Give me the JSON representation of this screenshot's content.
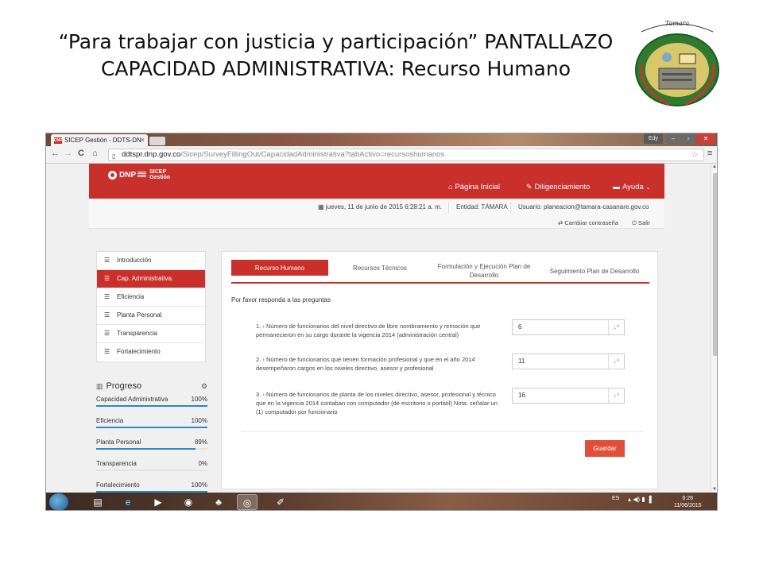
{
  "slide": {
    "title": "“Para trabajar con justicia y participación” PANTALLAZO CAPACIDAD ADMINISTRATIVA: Recurso Humano",
    "crest_text": "Tamara"
  },
  "browser": {
    "tab_title": "SICEP Gestión - DDTS-DN",
    "tab_close": "×",
    "user_button": "Edy",
    "url_host": "ddtspr.dnp.gov.co",
    "url_path": "/Sicep/SurveyFillingOut/CapacidadAdministrativa?tabActivo=recursoshumanos",
    "back": "←",
    "forward": "→",
    "reload": "C",
    "home": "⌂",
    "star": "☆",
    "menu": "≡"
  },
  "site": {
    "logo_dnp": "DNP",
    "logo_sicep": "SICEP",
    "logo_gestion": "Gestión",
    "nav": {
      "home": "Página Inicial",
      "fill": "Diligenciamiento",
      "help": "Ayuda"
    },
    "info": {
      "date": "jueves, 11 de junio de 2015 6:28:21 a. m.",
      "entity": "Entidad: TÁMARA",
      "user": "Usuario: planeacion@tamara-casanare.gov.co",
      "change_password": "Cambiar contraseña",
      "logout": "Salir"
    }
  },
  "sidebar": {
    "items": [
      {
        "label": "Introducción",
        "active": false
      },
      {
        "label": "Cap. Administrativa.",
        "active": true
      },
      {
        "label": "Eficiencia",
        "active": false
      },
      {
        "label": "Planta Personal",
        "active": false
      },
      {
        "label": "Transparencia",
        "active": false
      },
      {
        "label": "Fortalecimiento",
        "active": false
      }
    ]
  },
  "progress": {
    "title": "Progreso",
    "rows": [
      {
        "label": "Capacidad Administrativa",
        "value": "100%",
        "fraction": 1.0
      },
      {
        "label": "Eficiencia",
        "value": "100%",
        "fraction": 1.0
      },
      {
        "label": "Planta Personal",
        "value": "89%",
        "fraction": 0.89
      },
      {
        "label": "Transparencia",
        "value": "0%",
        "fraction": 0.0
      },
      {
        "label": "Fortalecimiento",
        "value": "100%",
        "fraction": 1.0
      }
    ]
  },
  "main": {
    "tabs": [
      {
        "label": "Recurso Humano",
        "active": true
      },
      {
        "label": "Recursos Técnicos",
        "active": false
      },
      {
        "label": "Formulación y Ejecución Plan de Desarrollo",
        "active": false
      },
      {
        "label": "Seguimiento Plan de Desarrollo",
        "active": false
      }
    ],
    "prompt": "Por favor responda a las preguntas",
    "questions": [
      {
        "num": "1.",
        "text": "Número de funcionarios del nivel directivo de libre nombramiento y remoción que permanecieron en su cargo durante la vigencia 2014 (administración central)",
        "answer": "6"
      },
      {
        "num": "2.",
        "text": "Número de funcionarios que tienen formación profesional y que en el año 2014 desempeñaron cargos en los niveles directivo, asesor y profesional",
        "answer": "11"
      },
      {
        "num": "3.",
        "text": "Número de funcionarios de planta de los niveles directivo, asesor, profesional y técnico que en la vigencia 2014 contaban con computador (de escritorio o portátil) Nota: señalar un (1) computador por funcionario",
        "answer": "16"
      }
    ],
    "save": "Guardar"
  },
  "taskbar": {
    "lang": "ES",
    "time": "6:28",
    "date": "11/06/2015"
  },
  "colors": {
    "brand_red": "#c9302c",
    "progress_blue": "#2d86c9",
    "save_red": "#e04f3a"
  }
}
